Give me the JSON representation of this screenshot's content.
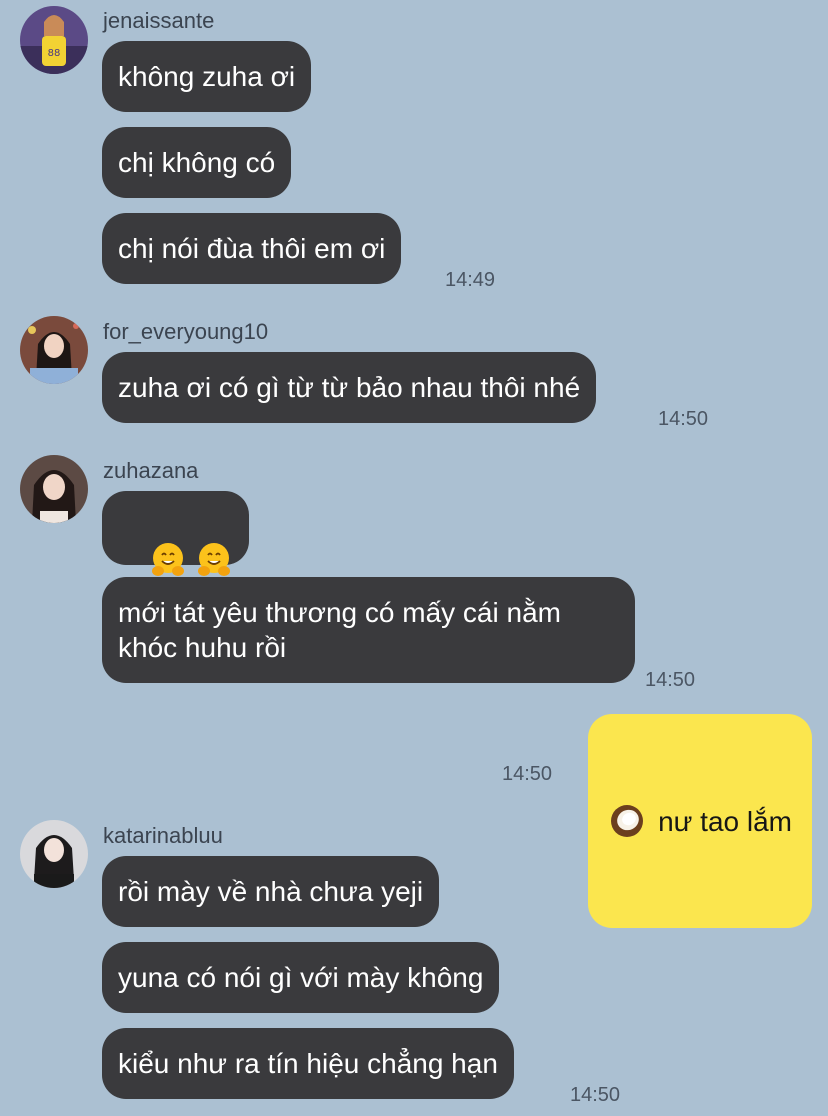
{
  "messages": {
    "jenaissante": {
      "name": "jenaissante",
      "m1": "không zuha ơi",
      "m2": "chị không có",
      "m3": "chị nói đùa thôi em ơi",
      "time": "14:49"
    },
    "everyoung": {
      "name": "for_everyoung10",
      "m1": "zuha ơi có gì từ từ bảo nhau thôi nhé",
      "time": "14:50"
    },
    "zuhazana": {
      "name": "zuhazana",
      "emoji": "hugging-face-emoji",
      "m2": "mới tát yêu thương có mấy cái nằm khóc huhu rồi",
      "time": "14:50"
    },
    "me": {
      "emoji": "coconut-emoji",
      "text": "nư tao lắm",
      "time": "14:50"
    },
    "katarinabluu": {
      "name": "katarinabluu",
      "m1": "rồi mày về nhà chưa yeji",
      "m2": "yuna có nói gì với mày không",
      "m3": "kiểu như ra tín hiệu chẳng hạn",
      "time": "14:50"
    }
  },
  "colors": {
    "background": "#abc0d2",
    "incoming_bubble": "#3a3a3d",
    "outgoing_bubble": "#fbe64e"
  }
}
